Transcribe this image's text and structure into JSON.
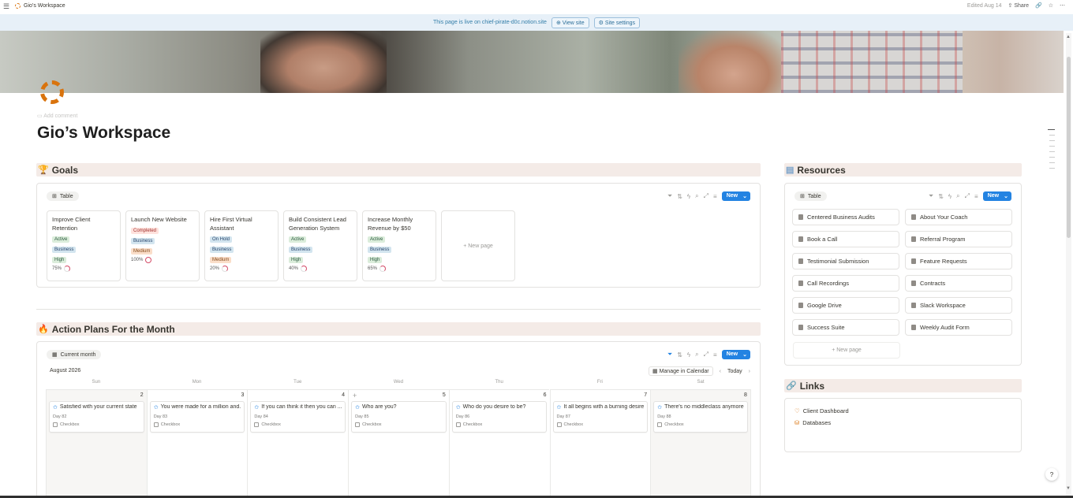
{
  "topbar": {
    "workspace_name": "Gio’s Workspace",
    "edited": "Edited Aug 14",
    "share": "Share"
  },
  "banner": {
    "text": "This page is live on chief-pirate-d0c.notion.site",
    "view_site": "View site",
    "site_settings": "Site settings"
  },
  "page": {
    "add_comment": "Add comment",
    "title": "Gio’s Workspace"
  },
  "goals": {
    "heading": "Goals",
    "view_label": "Table",
    "new_label": "New",
    "new_page": "New page",
    "cards": [
      {
        "title": "Improve Client Retention",
        "status": "Active",
        "category": "Business",
        "priority": "High",
        "progress": "75%"
      },
      {
        "title": "Launch New Website",
        "status": "Completed",
        "category": "Business",
        "priority": "Medium",
        "progress": "100%"
      },
      {
        "title": "Hire First Virtual Assistant",
        "status": "On Hold",
        "category": "Business",
        "priority": "Medium",
        "progress": "20%"
      },
      {
        "title": "Build Consistent Lead Generation System",
        "status": "Active",
        "category": "Business",
        "priority": "High",
        "progress": "40%"
      },
      {
        "title": "Increase Monthly Revenue by $50",
        "status": "Active",
        "category": "Business",
        "priority": "High",
        "progress": "65%"
      }
    ]
  },
  "resources": {
    "heading": "Resources",
    "view_label": "Table",
    "new_label": "New",
    "new_page": "New page",
    "items": [
      "Centered Business Audits",
      "About Your Coach",
      "Book a Call",
      "Referral Program",
      "Testimonial Submission",
      "Feature Requests",
      "Call Recordings",
      "Contracts",
      "Google Drive",
      "Slack Workspace",
      "Success Suite",
      "Weekly Audit Form"
    ]
  },
  "action_plans": {
    "heading": "Action Plans For the Month",
    "view_label": "Current month",
    "new_label": "New",
    "month": "August 2026",
    "manage": "Manage in Calendar",
    "today": "Today",
    "days": [
      "Sun",
      "Mon",
      "Tue",
      "Wed",
      "Thu",
      "Fri",
      "Sat"
    ],
    "events": [
      {
        "date": "2",
        "title": "Satisfied with your current state",
        "day": "Day 82",
        "check": "Checkbox"
      },
      {
        "date": "3",
        "title": "You were made for a million and...",
        "day": "Day 83",
        "check": "Checkbox"
      },
      {
        "date": "4",
        "title": "If you can think it then you can ...",
        "day": "Day 84",
        "check": "Checkbox"
      },
      {
        "date": "5",
        "title": "Who are you?",
        "day": "Day 85",
        "check": "Checkbox"
      },
      {
        "date": "6",
        "title": "Who do you desire to be?",
        "day": "Day 86",
        "check": "Checkbox"
      },
      {
        "date": "7",
        "title": "It all begins with a burning desire",
        "day": "Day 87",
        "check": "Checkbox"
      },
      {
        "date": "8",
        "title": "There's no middleclass anymore",
        "day": "Day 88",
        "check": "Checkbox"
      }
    ]
  },
  "links": {
    "heading": "Links",
    "items": [
      "Client Dashboard",
      "Databases"
    ]
  },
  "colors": {
    "accent": "#2383e2",
    "section_bg": "#f4ebe7",
    "icon_orange": "#d9730d",
    "progress_ring": "#d44c67"
  }
}
